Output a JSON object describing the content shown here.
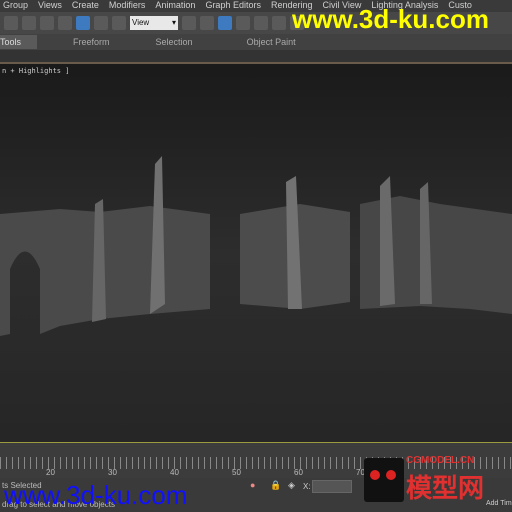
{
  "menu": [
    "Group",
    "Views",
    "Create",
    "Modifiers",
    "Animation",
    "Graph Editors",
    "Rendering",
    "Civil View",
    "Lighting Analysis",
    "Custo"
  ],
  "toolbar": {
    "view_dropdown": "View"
  },
  "ribbon": {
    "tabs": [
      "Tools",
      "Freeform",
      "Selection",
      "Object Paint"
    ]
  },
  "viewport": {
    "label": "n + Highlights ]"
  },
  "timeline": {
    "ticks": [
      "20",
      "30",
      "40",
      "50",
      "60",
      "70"
    ]
  },
  "status": {
    "selected": "ts Selected",
    "prompt": "drag to select and move objects",
    "x_label": "X:",
    "add_time": "Add Tim"
  },
  "watermarks": {
    "top": "www.3d-ku.com",
    "bottom": "www.3d-ku.com",
    "logo": "CGMODEL.CN 模型网"
  }
}
